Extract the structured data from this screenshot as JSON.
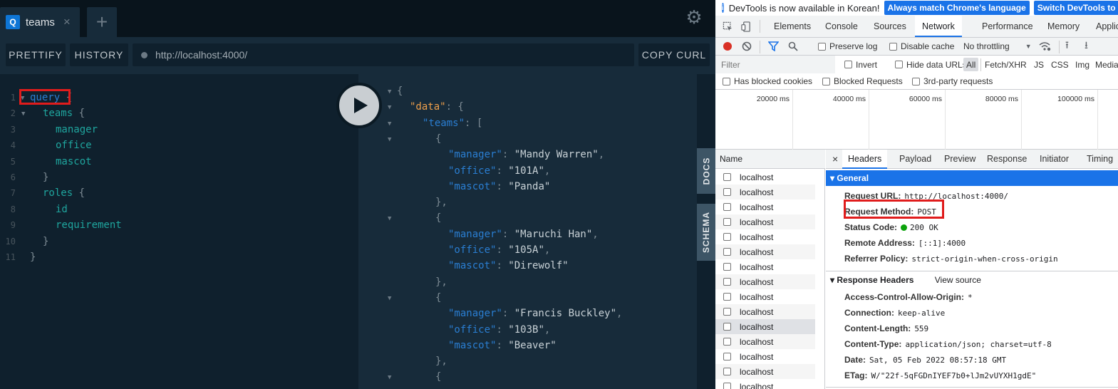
{
  "playground": {
    "tab": {
      "badge": "Q",
      "title": "teams",
      "close": "×"
    },
    "new_tab": "+",
    "toolbar": {
      "prettify": "PRETTIFY",
      "history": "HISTORY",
      "url": "http://localhost:4000/",
      "copy_curl": "COPY CURL"
    },
    "side_tabs": {
      "docs": "DOCS",
      "schema": "SCHEMA"
    },
    "query_lines": [
      {
        "n": "1",
        "indent": 0,
        "parts": [
          {
            "t": "query",
            "c": "c-kw"
          },
          {
            "t": " {",
            "c": "c-punc"
          }
        ],
        "fold": true
      },
      {
        "n": "2",
        "indent": 1,
        "parts": [
          {
            "t": "teams",
            "c": "c-field"
          },
          {
            "t": " {",
            "c": "c-punc"
          }
        ],
        "fold": true
      },
      {
        "n": "3",
        "indent": 2,
        "parts": [
          {
            "t": "manager",
            "c": "c-field"
          }
        ]
      },
      {
        "n": "4",
        "indent": 2,
        "parts": [
          {
            "t": "office",
            "c": "c-field"
          }
        ]
      },
      {
        "n": "5",
        "indent": 2,
        "parts": [
          {
            "t": "mascot",
            "c": "c-field"
          }
        ]
      },
      {
        "n": "6",
        "indent": 1,
        "parts": [
          {
            "t": "}",
            "c": "c-punc"
          }
        ]
      },
      {
        "n": "7",
        "indent": 1,
        "parts": [
          {
            "t": "roles",
            "c": "c-field"
          },
          {
            "t": " {",
            "c": "c-punc"
          }
        ]
      },
      {
        "n": "8",
        "indent": 2,
        "parts": [
          {
            "t": "id",
            "c": "c-field"
          }
        ]
      },
      {
        "n": "9",
        "indent": 2,
        "parts": [
          {
            "t": "requirement",
            "c": "c-field"
          }
        ]
      },
      {
        "n": "10",
        "indent": 1,
        "parts": [
          {
            "t": "}",
            "c": "c-punc"
          }
        ]
      },
      {
        "n": "11",
        "indent": 0,
        "parts": [
          {
            "t": "}",
            "c": "c-punc"
          }
        ]
      }
    ],
    "result_lines": [
      {
        "fold": true,
        "indent": 0,
        "parts": [
          {
            "t": "{",
            "c": "c-punc"
          }
        ]
      },
      {
        "fold": true,
        "indent": 1,
        "parts": [
          {
            "t": "\"data\"",
            "c": "c-data"
          },
          {
            "t": ": {",
            "c": "c-punc"
          }
        ]
      },
      {
        "fold": true,
        "indent": 2,
        "parts": [
          {
            "t": "\"teams\"",
            "c": "c-key"
          },
          {
            "t": ": [",
            "c": "c-punc"
          }
        ]
      },
      {
        "fold": true,
        "indent": 3,
        "parts": [
          {
            "t": "{",
            "c": "c-punc"
          }
        ]
      },
      {
        "indent": 4,
        "parts": [
          {
            "t": "\"manager\"",
            "c": "c-key"
          },
          {
            "t": ": ",
            "c": "c-punc"
          },
          {
            "t": "\"Mandy Warren\"",
            "c": "c-str"
          },
          {
            "t": ",",
            "c": "c-punc"
          }
        ]
      },
      {
        "indent": 4,
        "parts": [
          {
            "t": "\"office\"",
            "c": "c-key"
          },
          {
            "t": ": ",
            "c": "c-punc"
          },
          {
            "t": "\"101A\"",
            "c": "c-str"
          },
          {
            "t": ",",
            "c": "c-punc"
          }
        ]
      },
      {
        "indent": 4,
        "parts": [
          {
            "t": "\"mascot\"",
            "c": "c-key"
          },
          {
            "t": ": ",
            "c": "c-punc"
          },
          {
            "t": "\"Panda\"",
            "c": "c-str"
          }
        ]
      },
      {
        "indent": 3,
        "parts": [
          {
            "t": "},",
            "c": "c-punc"
          }
        ]
      },
      {
        "fold": true,
        "indent": 3,
        "parts": [
          {
            "t": "{",
            "c": "c-punc"
          }
        ]
      },
      {
        "indent": 4,
        "parts": [
          {
            "t": "\"manager\"",
            "c": "c-key"
          },
          {
            "t": ": ",
            "c": "c-punc"
          },
          {
            "t": "\"Maruchi Han\"",
            "c": "c-str"
          },
          {
            "t": ",",
            "c": "c-punc"
          }
        ]
      },
      {
        "indent": 4,
        "parts": [
          {
            "t": "\"office\"",
            "c": "c-key"
          },
          {
            "t": ": ",
            "c": "c-punc"
          },
          {
            "t": "\"105A\"",
            "c": "c-str"
          },
          {
            "t": ",",
            "c": "c-punc"
          }
        ]
      },
      {
        "indent": 4,
        "parts": [
          {
            "t": "\"mascot\"",
            "c": "c-key"
          },
          {
            "t": ": ",
            "c": "c-punc"
          },
          {
            "t": "\"Direwolf\"",
            "c": "c-str"
          }
        ]
      },
      {
        "indent": 3,
        "parts": [
          {
            "t": "},",
            "c": "c-punc"
          }
        ]
      },
      {
        "fold": true,
        "indent": 3,
        "parts": [
          {
            "t": "{",
            "c": "c-punc"
          }
        ]
      },
      {
        "indent": 4,
        "parts": [
          {
            "t": "\"manager\"",
            "c": "c-key"
          },
          {
            "t": ": ",
            "c": "c-punc"
          },
          {
            "t": "\"Francis Buckley\"",
            "c": "c-str"
          },
          {
            "t": ",",
            "c": "c-punc"
          }
        ]
      },
      {
        "indent": 4,
        "parts": [
          {
            "t": "\"office\"",
            "c": "c-key"
          },
          {
            "t": ": ",
            "c": "c-punc"
          },
          {
            "t": "\"103B\"",
            "c": "c-str"
          },
          {
            "t": ",",
            "c": "c-punc"
          }
        ]
      },
      {
        "indent": 4,
        "parts": [
          {
            "t": "\"mascot\"",
            "c": "c-key"
          },
          {
            "t": ": ",
            "c": "c-punc"
          },
          {
            "t": "\"Beaver\"",
            "c": "c-str"
          }
        ]
      },
      {
        "indent": 3,
        "parts": [
          {
            "t": "},",
            "c": "c-punc"
          }
        ]
      },
      {
        "fold": true,
        "indent": 3,
        "parts": [
          {
            "t": "{",
            "c": "c-punc"
          }
        ]
      }
    ]
  },
  "devtools": {
    "banner": {
      "text": "DevTools is now available in Korean!",
      "btn_match": "Always match Chrome's language",
      "btn_switch": "Switch DevTools to Kor"
    },
    "tabs": [
      "Elements",
      "Console",
      "Sources",
      "Network",
      "Performance",
      "Memory",
      "Applicat"
    ],
    "active_tab": "Network",
    "toolbar": {
      "preserve_log": "Preserve log",
      "disable_cache": "Disable cache",
      "throttling": "No throttling"
    },
    "filter": {
      "placeholder": "Filter",
      "invert": "Invert",
      "hide_data_urls": "Hide data URLs",
      "types": [
        "All",
        "Fetch/XHR",
        "JS",
        "CSS",
        "Img",
        "Media"
      ]
    },
    "filter2": {
      "blocked_cookies": "Has blocked cookies",
      "blocked_requests": "Blocked Requests",
      "third_party": "3rd-party requests"
    },
    "timeline_labels": [
      "20000 ms",
      "40000 ms",
      "60000 ms",
      "80000 ms",
      "100000 ms"
    ],
    "name_header": "Name",
    "requests": [
      "localhost",
      "localhost",
      "localhost",
      "localhost",
      "localhost",
      "localhost",
      "localhost",
      "localhost",
      "localhost",
      "localhost",
      "localhost",
      "localhost",
      "localhost",
      "localhost",
      "localhost"
    ],
    "selected_request": 10,
    "detail_tabs": [
      "Headers",
      "Payload",
      "Preview",
      "Response",
      "Initiator",
      "Timing"
    ],
    "detail_close": "×",
    "general": {
      "title": "General",
      "rows": [
        {
          "k": "Request URL:",
          "v": "http://localhost:4000/"
        },
        {
          "k": "Request Method:",
          "v": "POST"
        },
        {
          "k": "Status Code:",
          "v": "200 OK"
        },
        {
          "k": "Remote Address:",
          "v": "[::1]:4000"
        },
        {
          "k": "Referrer Policy:",
          "v": "strict-origin-when-cross-origin"
        }
      ]
    },
    "response_headers": {
      "title": "Response Headers",
      "view_source": "View source",
      "rows": [
        {
          "k": "Access-Control-Allow-Origin:",
          "v": "*"
        },
        {
          "k": "Connection:",
          "v": "keep-alive"
        },
        {
          "k": "Content-Length:",
          "v": "559"
        },
        {
          "k": "Content-Type:",
          "v": "application/json; charset=utf-8"
        },
        {
          "k": "Date:",
          "v": "Sat, 05 Feb 2022 08:57:18 GMT"
        },
        {
          "k": "ETag:",
          "v": "W/\"22f-5qFGDnIYEF7b0+lJm2vUYXH1gdE\""
        }
      ]
    }
  }
}
